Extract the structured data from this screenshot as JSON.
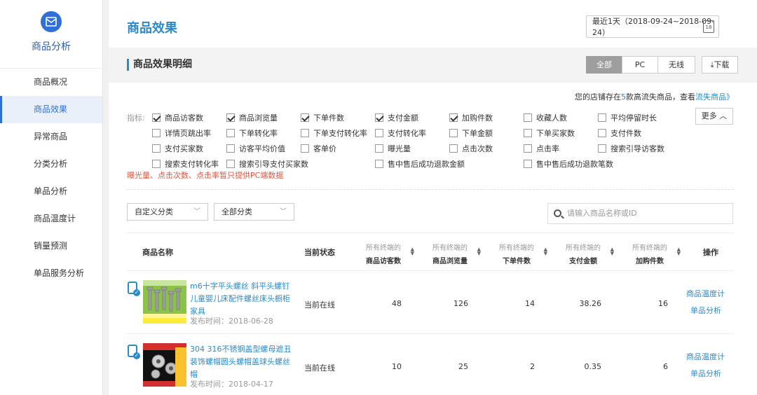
{
  "sidebar": {
    "title": "商品分析",
    "items": [
      {
        "label": "商品概况",
        "active": false
      },
      {
        "label": "商品效果",
        "active": true
      },
      {
        "label": "异常商品",
        "active": false
      },
      {
        "label": "分类分析",
        "active": false
      },
      {
        "label": "单品分析",
        "active": false
      },
      {
        "label": "商品温度计",
        "active": false
      },
      {
        "label": "销量预测",
        "active": false
      },
      {
        "label": "单品服务分析",
        "active": false
      }
    ]
  },
  "header": {
    "title": "商品效果",
    "date_range": "最近1天（2018-09-24~2018-09-24）",
    "calendar_day": "18"
  },
  "section": {
    "title": "商品效果明细",
    "tabs": [
      {
        "label": "全部",
        "active": true
      },
      {
        "label": "PC",
        "active": false
      },
      {
        "label": "无线",
        "active": false
      }
    ],
    "download_label": "下载"
  },
  "notice": {
    "prefix": "您的店铺存在",
    "count": "5",
    "middle": "款高流失商品，查看",
    "link": "流失商品》"
  },
  "metrics": {
    "label": "指标:",
    "more_label": "更多",
    "options": [
      {
        "label": "商品访客数",
        "checked": true
      },
      {
        "label": "商品浏览量",
        "checked": true
      },
      {
        "label": "下单件数",
        "checked": true
      },
      {
        "label": "支付金额",
        "checked": true
      },
      {
        "label": "加购件数",
        "checked": true
      },
      {
        "label": "收藏人数",
        "checked": false
      },
      {
        "label": "平均停留时长",
        "checked": false
      },
      {
        "label": "详情页跳出率",
        "checked": false
      },
      {
        "label": "下单转化率",
        "checked": false
      },
      {
        "label": "下单支付转化率",
        "checked": false
      },
      {
        "label": "支付转化率",
        "checked": false
      },
      {
        "label": "下单金额",
        "checked": false
      },
      {
        "label": "下单买家数",
        "checked": false
      },
      {
        "label": "支付件数",
        "checked": false
      },
      {
        "label": "支付买家数",
        "checked": false
      },
      {
        "label": "访客平均价值",
        "checked": false
      },
      {
        "label": "客单价",
        "checked": false
      },
      {
        "label": "曝光量",
        "checked": false
      },
      {
        "label": "点击次数",
        "checked": false
      },
      {
        "label": "点击率",
        "checked": false
      },
      {
        "label": "搜索引导访客数",
        "checked": false
      },
      {
        "label": "搜索支付转化率",
        "checked": false
      },
      {
        "label": "搜索引导支付买家数",
        "checked": false
      },
      {
        "label": "售中售后成功退款金额",
        "checked": false
      },
      {
        "label": "售中售后成功退款笔数",
        "checked": false
      }
    ],
    "warning": "曝光量、点击次数、点击率暂只提供PC端数据"
  },
  "filters": {
    "custom_category": "自定义分类",
    "all_category": "全部分类",
    "search_placeholder": "请输入商品名称或ID"
  },
  "table": {
    "col_name": "商品名称",
    "col_status": "当前状态",
    "col_prefix": "所有终端的",
    "col_visitors": "商品访客数",
    "col_views": "商品浏览量",
    "col_orders": "下单件数",
    "col_pay": "支付金额",
    "col_cart": "加购件数",
    "col_ops": "操作",
    "rows": [
      {
        "name": "m6十字平头螺丝 斜平头螺钉儿童婴儿床配件螺丝床头橱柜家具",
        "date": "发布时间：2018-06-28",
        "status": "当前在线",
        "visitors": "48",
        "views": "126",
        "orders": "14",
        "pay": "38.26",
        "cart": "16",
        "op1": "商品温度计",
        "op2": "单品分析"
      },
      {
        "name": "304 316不锈钢盖型螺母遮丑装饰螺帽圆头螺帽盖球头螺丝帽",
        "date": "发布时间：2018-04-17",
        "status": "当前在线",
        "visitors": "10",
        "views": "25",
        "orders": "2",
        "pay": "0.35",
        "cart": "6",
        "op1": "商品温度计",
        "op2": "单品分析"
      }
    ]
  }
}
